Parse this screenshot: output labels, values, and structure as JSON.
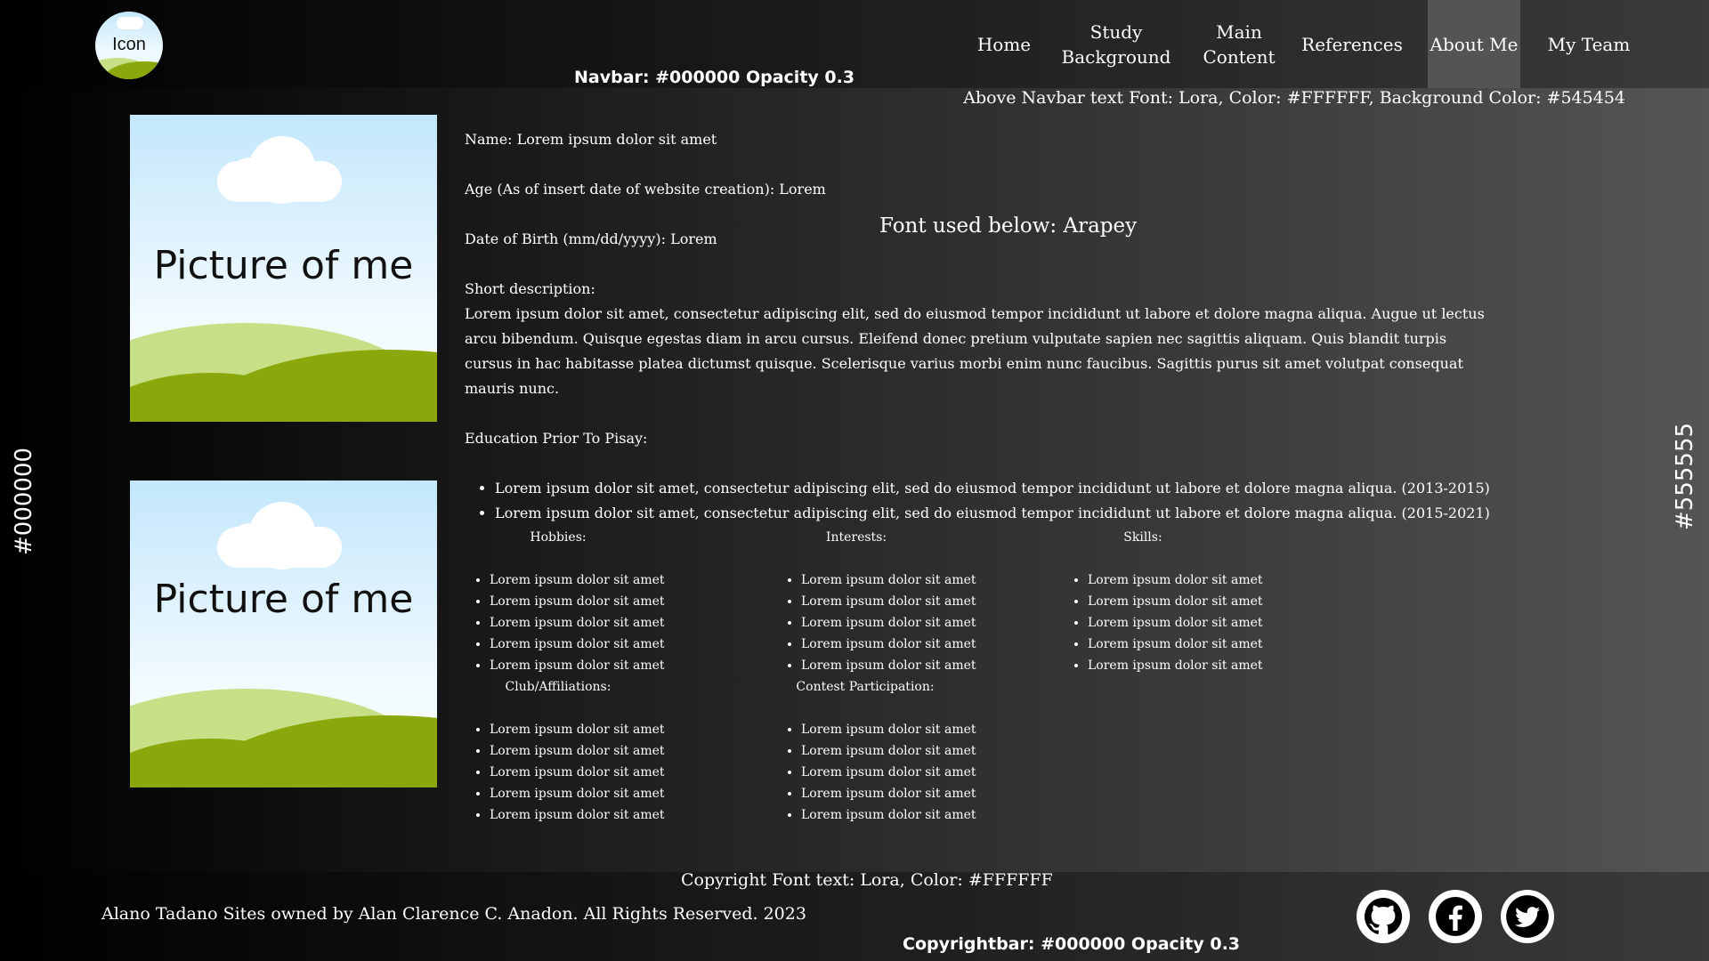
{
  "navbar": {
    "logo_label": "Icon",
    "items": [
      {
        "line1": "Home",
        "line2": ""
      },
      {
        "line1": "Study",
        "line2": "Background"
      },
      {
        "line1": "Main",
        "line2": "Content"
      },
      {
        "line1": "References",
        "line2": ""
      },
      {
        "line1": "About Me",
        "line2": ""
      },
      {
        "line1": "My Team",
        "line2": ""
      }
    ],
    "active": "About Me",
    "note": "Navbar: #000000 Opacity 0.3",
    "above_note": "Above Navbar text Font: Lora, Color: #FFFFFF, Background Color: #545454"
  },
  "pictures": [
    {
      "caption": "Picture of me"
    },
    {
      "caption": "Picture of me"
    }
  ],
  "side_labels": {
    "left": "#000000",
    "right": "#555555"
  },
  "font_note": "Font used below: Arapey",
  "profile": {
    "name": "Name: Lorem ipsum dolor sit amet",
    "age": "Age (As of insert date of website creation): Lorem",
    "dob": "Date of Birth (mm/dd/yyyy): Lorem",
    "short_desc_label": "Short description:",
    "short_desc": "Lorem ipsum dolor sit amet, consectetur adipiscing elit, sed do eiusmod tempor incididunt ut labore et dolore magna aliqua. Augue ut lectus arcu bibendum. Quisque egestas diam in arcu cursus. Eleifend donec pretium vulputate sapien nec sagittis aliquam. Quis blandit turpis cursus in hac habitasse platea dictumst quisque. Scelerisque varius morbi enim nunc faucibus. Sagittis purus sit amet volutpat consequat mauris nunc.",
    "education_label": "Education Prior To Pisay:",
    "education": [
      "Lorem ipsum dolor sit amet, consectetur adipiscing elit, sed do eiusmod tempor incididunt ut labore et dolore magna aliqua. (2013-2015)",
      "Lorem ipsum dolor sit amet, consectetur adipiscing elit, sed do eiusmod tempor incididunt ut labore et dolore magna aliqua. (2015-2021)"
    ]
  },
  "columns": {
    "hobbies": {
      "title": "Hobbies:",
      "items": [
        "Lorem ipsum dolor sit amet",
        "Lorem ipsum dolor sit amet",
        "Lorem ipsum dolor sit amet",
        "Lorem ipsum dolor sit amet",
        "Lorem ipsum dolor sit amet"
      ]
    },
    "interests": {
      "title": "Interests:",
      "items": [
        "Lorem ipsum dolor sit amet",
        "Lorem ipsum dolor sit amet",
        "Lorem ipsum dolor sit amet",
        "Lorem ipsum dolor sit amet",
        "Lorem ipsum dolor sit amet"
      ]
    },
    "skills": {
      "title": "Skills:",
      "items": [
        "Lorem ipsum dolor sit amet",
        "Lorem ipsum dolor sit amet",
        "Lorem ipsum dolor sit amet",
        "Lorem ipsum dolor sit amet",
        "Lorem ipsum dolor sit amet"
      ]
    },
    "clubs": {
      "title": "Club/Affiliations:",
      "items": [
        "Lorem ipsum dolor sit amet",
        "Lorem ipsum dolor sit amet",
        "Lorem ipsum dolor sit amet",
        "Lorem ipsum dolor sit amet",
        "Lorem ipsum dolor sit amet"
      ]
    },
    "contests": {
      "title": "Contest Participation:",
      "items": [
        "Lorem ipsum dolor sit amet",
        "Lorem ipsum dolor sit amet",
        "Lorem ipsum dolor sit amet",
        "Lorem ipsum dolor sit amet",
        "Lorem ipsum dolor sit amet"
      ]
    }
  },
  "footer": {
    "copyright_note": "Copyright Font text: Lora, Color: #FFFFFF",
    "copyright": "Alano Tadano Sites owned by Alan Clarence C. Anadon. All Rights Reserved. 2023",
    "bar_note": "Copyrightbar: #000000 Opacity 0.3",
    "social": [
      "github-icon",
      "facebook-icon",
      "twitter-icon"
    ]
  }
}
